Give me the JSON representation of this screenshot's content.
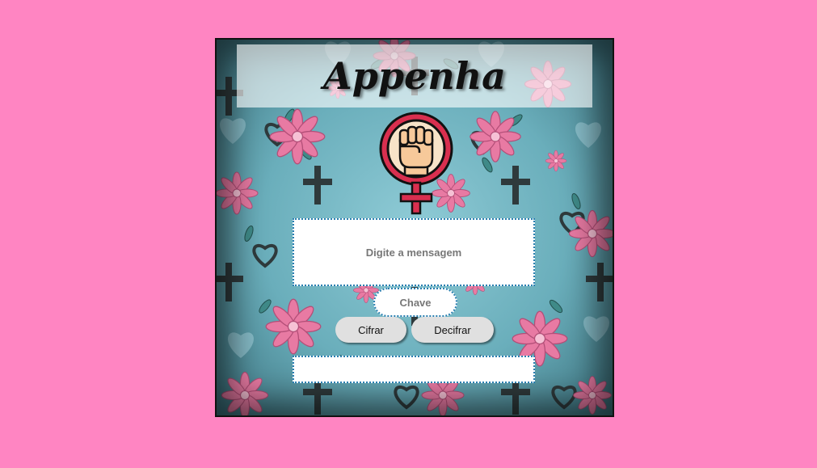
{
  "app": {
    "title": "Appenha"
  },
  "form": {
    "message_placeholder": "Digite a mensagem",
    "key_placeholder": "Chave",
    "output_value": ""
  },
  "buttons": {
    "encrypt_label": "Cifrar",
    "decrypt_label": "Decifrar"
  },
  "icons": {
    "logo": "feminist-fist-icon",
    "background_pattern": [
      "pink-flower",
      "heart",
      "cross"
    ]
  },
  "colors": {
    "page_background": "#ff85c2",
    "card_background": "#7fbfcb",
    "flower_pink": "#e87aa3",
    "logo_red": "#d92f4f",
    "input_border": "#2a7fb0",
    "button_gray": "#e0e0e0"
  }
}
